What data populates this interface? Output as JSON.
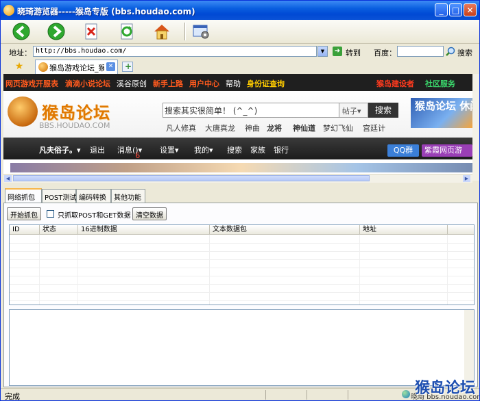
{
  "window": {
    "title": "晓琦游览器-----猴岛专版 (bbs.houdao.com)",
    "min_label": "_",
    "max_label": "□",
    "close_label": "✕"
  },
  "toolbar": {
    "icons": [
      "back-icon",
      "forward-icon",
      "stop-icon",
      "refresh-icon",
      "home-icon",
      "settings-icon"
    ]
  },
  "address": {
    "label": "地址：",
    "value": "http://bbs.houdao.com/",
    "go_label": "转到",
    "baidu_label": "百度：",
    "search_label": "搜索"
  },
  "tabs": [
    {
      "label": "猴岛游戏论坛_猴岛",
      "close": "✕"
    }
  ],
  "page": {
    "nav1": [
      {
        "text": "网页游戏开服表",
        "color": "#ff5a1e"
      },
      {
        "text": "滴滴小说论坛",
        "color": "#ff5a1e"
      },
      {
        "text": "溪谷原创",
        "color": "#ffffff"
      },
      {
        "text": "新手上路",
        "color": "#ff5a1e"
      },
      {
        "text": "用户中心",
        "color": "#ff5a1e"
      },
      {
        "text": "帮助",
        "color": "#ffffff"
      },
      {
        "text": "身份证查询",
        "color": "#ffcc00"
      },
      {
        "text": "猴岛建设者",
        "color": "#ff3a1e"
      },
      {
        "text": "社区服务",
        "color": "#3ad36a"
      }
    ],
    "logo_text": "猴岛论坛",
    "logo_sub": "BBS.HOUDAO.COM",
    "search_placeholder": "搜索其实很简单！ (^_^)",
    "search_select": "帖子▾",
    "search_button": "搜索",
    "hotlinks": [
      "凡人修真",
      "大唐真龙",
      "神曲",
      "龙将",
      "神仙道",
      "梦幻飞仙",
      "宫廷计"
    ],
    "ad_text": "猴岛论坛 休闲、娱",
    "nav2": [
      "凡夫俗子。▾",
      "退出",
      "消息(6)▾",
      "设置▾",
      "我的▾",
      "搜索",
      "家族",
      "银行"
    ],
    "qq_label": "QQ群",
    "zx_label": "紫霞网页游"
  },
  "tools": {
    "tabs": [
      "网络抓包",
      "POST测试",
      "编码转换",
      "其他功能"
    ],
    "start_button": "开始抓包",
    "checkbox_label": "只抓取POST和GET数据",
    "clear_button": "清空数据",
    "columns": [
      "ID",
      "状态",
      "16进制数据",
      "文本数据包",
      "地址"
    ]
  },
  "status": {
    "text": "完成",
    "watermark": "猴岛论坛",
    "watermark_sub": "晓琦 bbs.houdao.com"
  }
}
